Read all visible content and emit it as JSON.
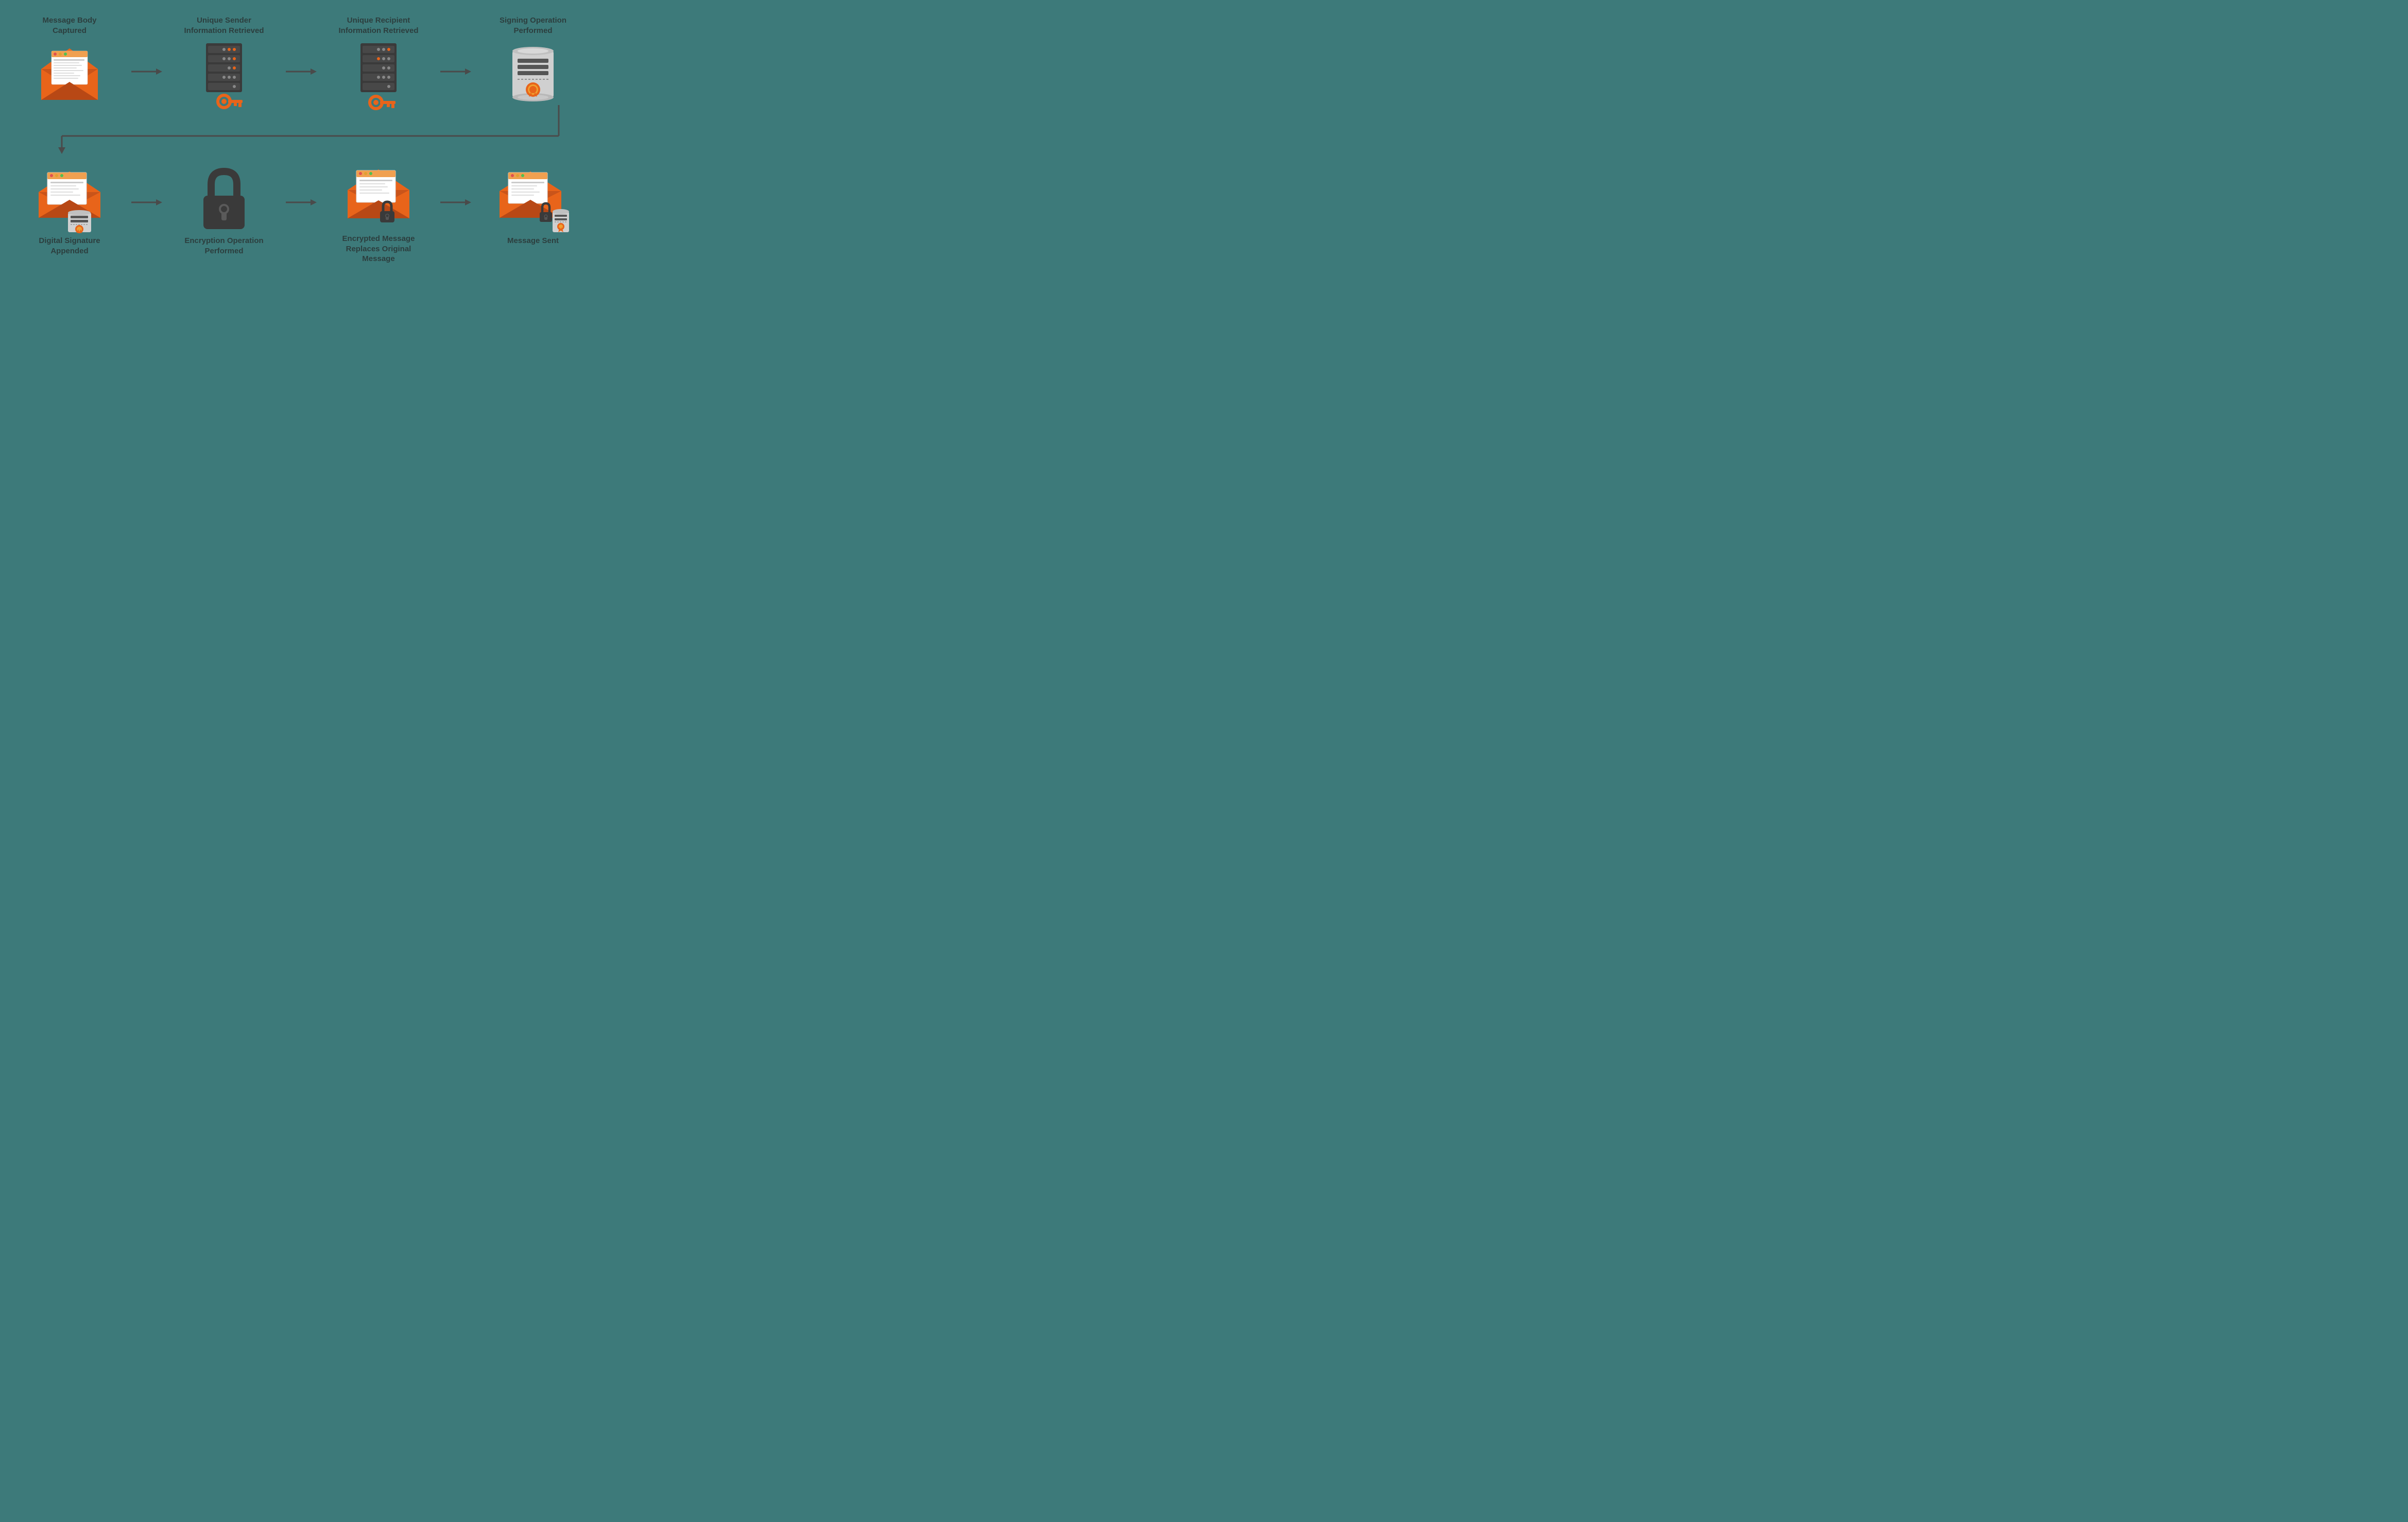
{
  "row_top": {
    "steps": [
      {
        "id": "message-body",
        "label": "Message Body\nCaptured",
        "icon": "email-open"
      },
      {
        "id": "sender-info",
        "label": "Unique Sender\nInformation Retrieved",
        "icon": "server-key"
      },
      {
        "id": "recipient-info",
        "label": "Unique Recipient\nInformation Retrieved",
        "icon": "server-key"
      },
      {
        "id": "signing",
        "label": "Signing Operation\nPerformed",
        "icon": "certificate"
      }
    ]
  },
  "row_bottom": {
    "steps": [
      {
        "id": "digital-sig",
        "label": "Digital Signature\nAppended",
        "icon": "email-sig"
      },
      {
        "id": "encryption-op",
        "label": "Encryption Operation\nPerformed",
        "icon": "padlock"
      },
      {
        "id": "encrypted-msg",
        "label": "Encrypted Message\nReplaces Original\nMessage",
        "icon": "email-lock"
      },
      {
        "id": "message-sent",
        "label": "Message Sent",
        "icon": "email-lock-cert"
      }
    ]
  },
  "colors": {
    "background": "#3d7a7a",
    "arrow": "#4a4a4a",
    "orange": "#e8641a",
    "dark": "#333333",
    "server_dark": "#3d3d3d",
    "server_light": "#555",
    "text": "#2c3e3e",
    "padlock": "#3d3d3d",
    "cert_gray": "#c8c8c8",
    "key_orange": "#e8641a"
  }
}
